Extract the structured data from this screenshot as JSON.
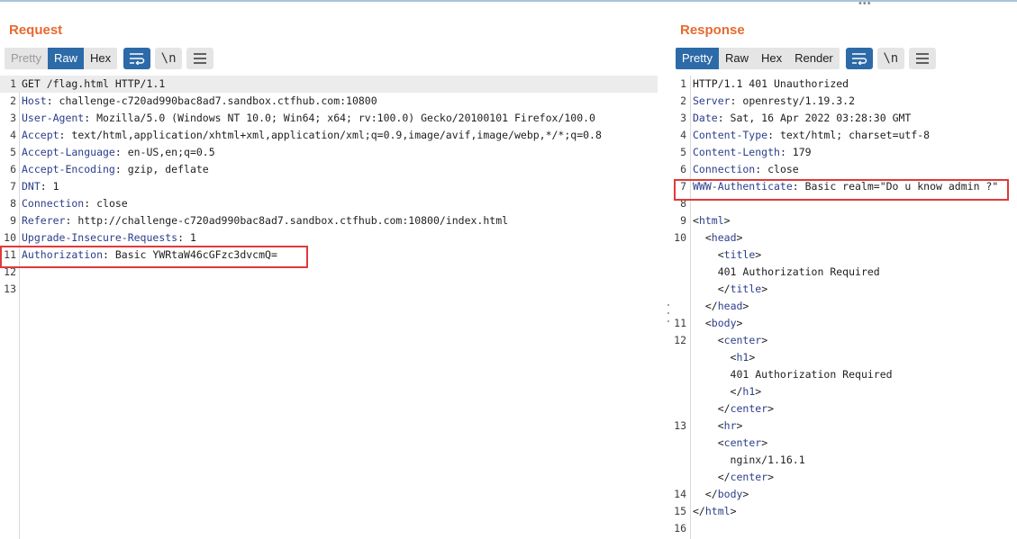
{
  "request": {
    "title": "Request",
    "view_options": [
      "Pretty",
      "Raw",
      "Hex"
    ],
    "active_option": "Raw",
    "newline_toggle": "\\n",
    "lines": [
      {
        "n": "1",
        "key": "",
        "val": "GET /flag.html HTTP/1.1"
      },
      {
        "n": "2",
        "key": "Host",
        "val": ": challenge-c720ad990bac8ad7.sandbox.ctfhub.com:10800"
      },
      {
        "n": "3",
        "key": "User-Agent",
        "val": ": Mozilla/5.0 (Windows NT 10.0; Win64; x64; rv:100.0) Gecko/20100101 Firefox/100.0"
      },
      {
        "n": "4",
        "key": "Accept",
        "val": ": text/html,application/xhtml+xml,application/xml;q=0.9,image/avif,image/webp,*/*;q=0.8"
      },
      {
        "n": "5",
        "key": "Accept-Language",
        "val": ": en-US,en;q=0.5"
      },
      {
        "n": "6",
        "key": "Accept-Encoding",
        "val": ": gzip, deflate"
      },
      {
        "n": "7",
        "key": "DNT",
        "val": ": 1"
      },
      {
        "n": "8",
        "key": "Connection",
        "val": ": close"
      },
      {
        "n": "9",
        "key": "Referer",
        "val": ": http://challenge-c720ad990bac8ad7.sandbox.ctfhub.com:10800/index.html"
      },
      {
        "n": "10",
        "key": "Upgrade-Insecure-Requests",
        "val": ": 1"
      },
      {
        "n": "11",
        "key": "Authorization",
        "val": ": Basic YWRtaW46cGFzc3dvcmQ="
      },
      {
        "n": "12",
        "key": "",
        "val": ""
      },
      {
        "n": "13",
        "key": "",
        "val": ""
      }
    ]
  },
  "response": {
    "title": "Response",
    "view_options": [
      "Pretty",
      "Raw",
      "Hex",
      "Render"
    ],
    "active_option": "Pretty",
    "newline_toggle": "\\n",
    "lines": [
      {
        "n": "1",
        "key": "",
        "val": "HTTP/1.1 401 Unauthorized"
      },
      {
        "n": "2",
        "key": "Server",
        "val": ": openresty/1.19.3.2"
      },
      {
        "n": "3",
        "key": "Date",
        "val": ": Sat, 16 Apr 2022 03:28:30 GMT"
      },
      {
        "n": "4",
        "key": "Content-Type",
        "val": ": text/html; charset=utf-8"
      },
      {
        "n": "5",
        "key": "Content-Length",
        "val": ": 179"
      },
      {
        "n": "6",
        "key": "Connection",
        "val": ": close"
      },
      {
        "n": "7",
        "key": "WWW-Authenticate",
        "val": ": Basic realm=\"Do u know admin ?\""
      },
      {
        "n": "8",
        "key": "",
        "val": ""
      },
      {
        "n": "9",
        "indent": "",
        "pre": "<",
        "tag": "html",
        "post": ">"
      },
      {
        "n": "10",
        "indent": "  ",
        "pre": "<",
        "tag": "head",
        "post": ">"
      },
      {
        "n": "",
        "indent": "    ",
        "pre": "<",
        "tag": "title",
        "post": ">"
      },
      {
        "n": "",
        "indent": "    ",
        "text": "401 Authorization Required"
      },
      {
        "n": "",
        "indent": "    ",
        "pre": "</",
        "tag": "title",
        "post": ">"
      },
      {
        "n": "",
        "indent": "  ",
        "pre": "</",
        "tag": "head",
        "post": ">"
      },
      {
        "n": "11",
        "indent": "  ",
        "pre": "<",
        "tag": "body",
        "post": ">"
      },
      {
        "n": "12",
        "indent": "    ",
        "pre": "<",
        "tag": "center",
        "post": ">"
      },
      {
        "n": "",
        "indent": "      ",
        "pre": "<",
        "tag": "h1",
        "post": ">"
      },
      {
        "n": "",
        "indent": "      ",
        "text": "401 Authorization Required"
      },
      {
        "n": "",
        "indent": "      ",
        "pre": "</",
        "tag": "h1",
        "post": ">"
      },
      {
        "n": "",
        "indent": "    ",
        "pre": "</",
        "tag": "center",
        "post": ">"
      },
      {
        "n": "13",
        "indent": "    ",
        "pre": "<",
        "tag": "hr",
        "post": ">"
      },
      {
        "n": "",
        "indent": "    ",
        "pre": "<",
        "tag": "center",
        "post": ">"
      },
      {
        "n": "",
        "indent": "      ",
        "text": "nginx/1.16.1"
      },
      {
        "n": "",
        "indent": "    ",
        "pre": "</",
        "tag": "center",
        "post": ">"
      },
      {
        "n": "14",
        "indent": "  ",
        "pre": "</",
        "tag": "body",
        "post": ">"
      },
      {
        "n": "15",
        "indent": "",
        "pre": "</",
        "tag": "html",
        "post": ">"
      },
      {
        "n": "16",
        "indent": "",
        "text": ""
      }
    ]
  },
  "colors": {
    "title_orange": "#e8692e",
    "active_blue": "#2d6aa8",
    "header_key_blue": "#2b3e8a",
    "highlight_red": "#e03a3a"
  },
  "icons": [
    "wrap-lines-icon",
    "newline-icon",
    "hamburger-menu-icon"
  ]
}
